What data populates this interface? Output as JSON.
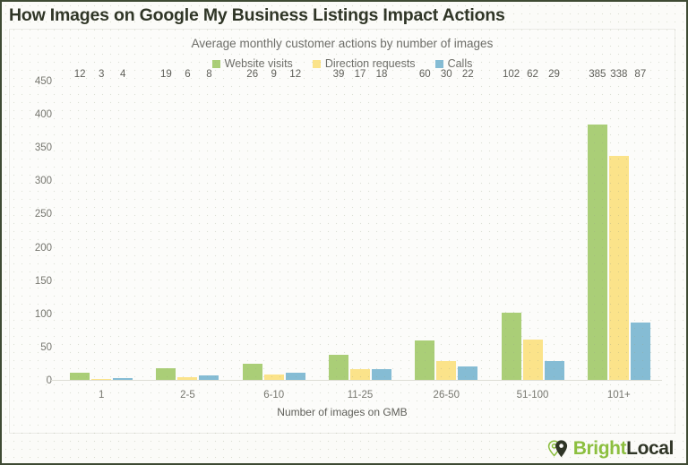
{
  "page_title": "How Images on Google My Business Listings Impact Actions",
  "logo": {
    "icon": "map-pin-icon",
    "part1": "Bright",
    "part2": "Local"
  },
  "colors": {
    "website_visits": "#aace77",
    "direction_requests": "#fbe38a",
    "calls": "#85bcd4",
    "title": "#2f3526",
    "axis_text": "#76766f",
    "border": "#3e4a33"
  },
  "chart_data": {
    "type": "bar",
    "title": "Average monthly customer actions by number of images",
    "xlabel": "Number of images on GMB",
    "ylabel": "",
    "ylim": [
      0,
      450
    ],
    "yticks": [
      450,
      400,
      350,
      300,
      250,
      200,
      150,
      100,
      50,
      0
    ],
    "categories": [
      "1",
      "2-5",
      "6-10",
      "11-25",
      "26-50",
      "51-100",
      "101+"
    ],
    "grid": false,
    "legend_position": "top",
    "series": [
      {
        "name": "Website visits",
        "color": "#aace77",
        "values": [
          12,
          19,
          26,
          39,
          60,
          102,
          385
        ]
      },
      {
        "name": "Direction requests",
        "color": "#fbe38a",
        "values": [
          3,
          6,
          9,
          17,
          30,
          62,
          338
        ]
      },
      {
        "name": "Calls",
        "color": "#85bcd4",
        "values": [
          4,
          8,
          12,
          18,
          22,
          29,
          87
        ]
      }
    ]
  }
}
